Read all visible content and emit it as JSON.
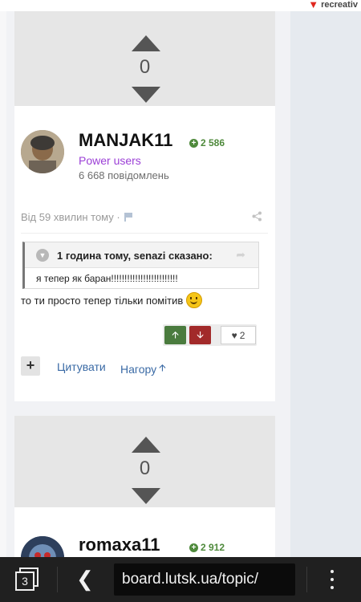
{
  "ad": {
    "label": "recreativ"
  },
  "posts": [
    {
      "votes": "0",
      "author": "MANJAK11",
      "reputation": "2 586",
      "group": "Power users",
      "post_count": "6 668 повідомлень",
      "date": "Від 59 хвилин тому ·",
      "quote": {
        "citation": "1 година тому, senazi сказано:",
        "text": "я тепер як баран!!!!!!!!!!!!!!!!!!!!!!!!!"
      },
      "text": "то ти просто тепер тільки помітив",
      "likes": "2",
      "actions": {
        "quote_label": "Цитувати",
        "top_label": "Нагору"
      }
    },
    {
      "votes": "0",
      "author": "romaxa11",
      "reputation": "2 912"
    }
  ],
  "browser": {
    "tab_count": "3",
    "url": "board.lutsk.ua/topic/"
  },
  "colors": {
    "reputation": "#4f8a3c",
    "group": "#9b3fd6",
    "link": "#3a6aa5",
    "upvote": "#4a7b3e",
    "downvote": "#a22a2a"
  }
}
